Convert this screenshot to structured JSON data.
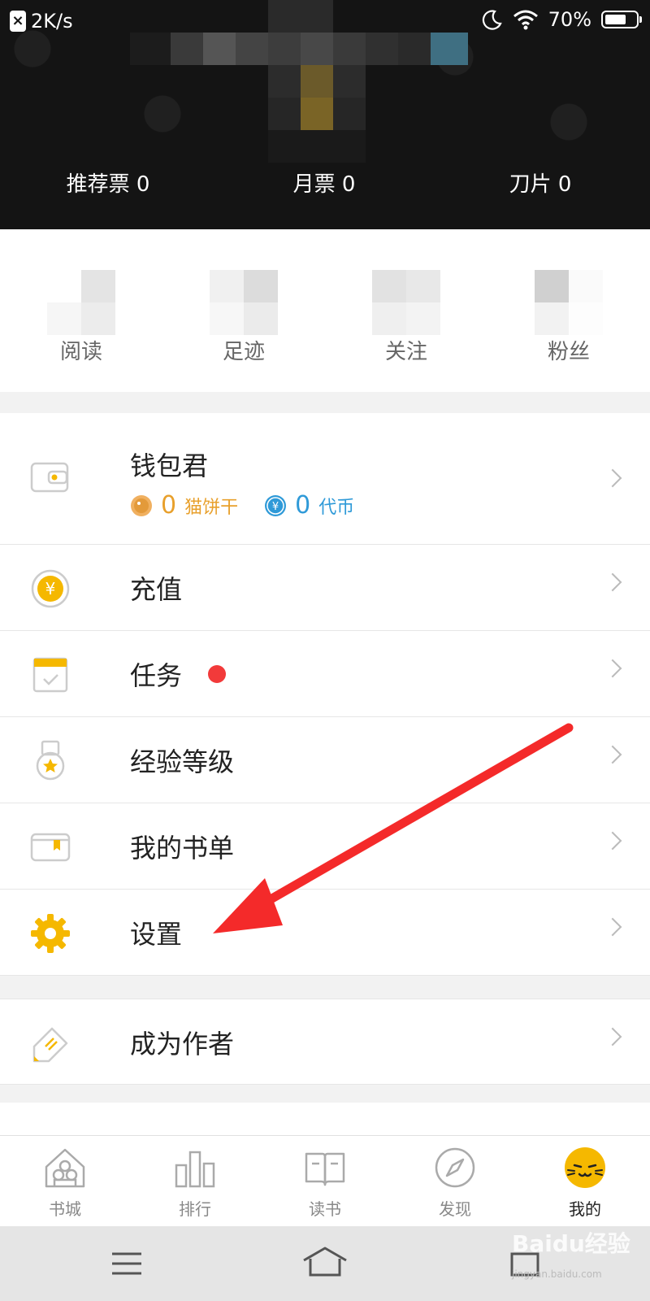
{
  "status_bar": {
    "speed": "2K/s",
    "battery": "70%",
    "battery_level": 0.7
  },
  "stats": [
    {
      "label": "推荐票 0"
    },
    {
      "label": "月票 0"
    },
    {
      "label": "刀片 0"
    }
  ],
  "quick_links": [
    "阅读",
    "足迹",
    "关注",
    "粉丝"
  ],
  "menu": {
    "wallet": {
      "title": "钱包君",
      "cat_biscuit_count": "0",
      "cat_biscuit_label": "猫饼干",
      "token_count": "0",
      "token_label": "代币"
    },
    "items": [
      {
        "label": "充值",
        "icon": "yuan-coin-icon"
      },
      {
        "label": "任务",
        "icon": "calendar-check-icon"
      },
      {
        "label": "经验等级",
        "icon": "medal-icon"
      },
      {
        "label": "我的书单",
        "icon": "booklist-icon"
      },
      {
        "label": "设置",
        "icon": "gear-icon"
      }
    ],
    "author": {
      "label": "成为作者",
      "icon": "pencil-card-icon"
    }
  },
  "tabs": [
    {
      "label": "书城",
      "icon": "house-icon"
    },
    {
      "label": "排行",
      "icon": "bars-icon"
    },
    {
      "label": "读书",
      "icon": "open-book-icon"
    },
    {
      "label": "发现",
      "icon": "compass-icon"
    },
    {
      "label": "我的",
      "icon": "cat-face-icon",
      "active": true
    }
  ],
  "watermark": {
    "text": "Baidu经验",
    "url": "jingyan.baidu.com"
  },
  "colors": {
    "accent": "#f5b800",
    "red": "#f23a3a",
    "blue": "#2f9ad8",
    "orange": "#e8a02c"
  }
}
